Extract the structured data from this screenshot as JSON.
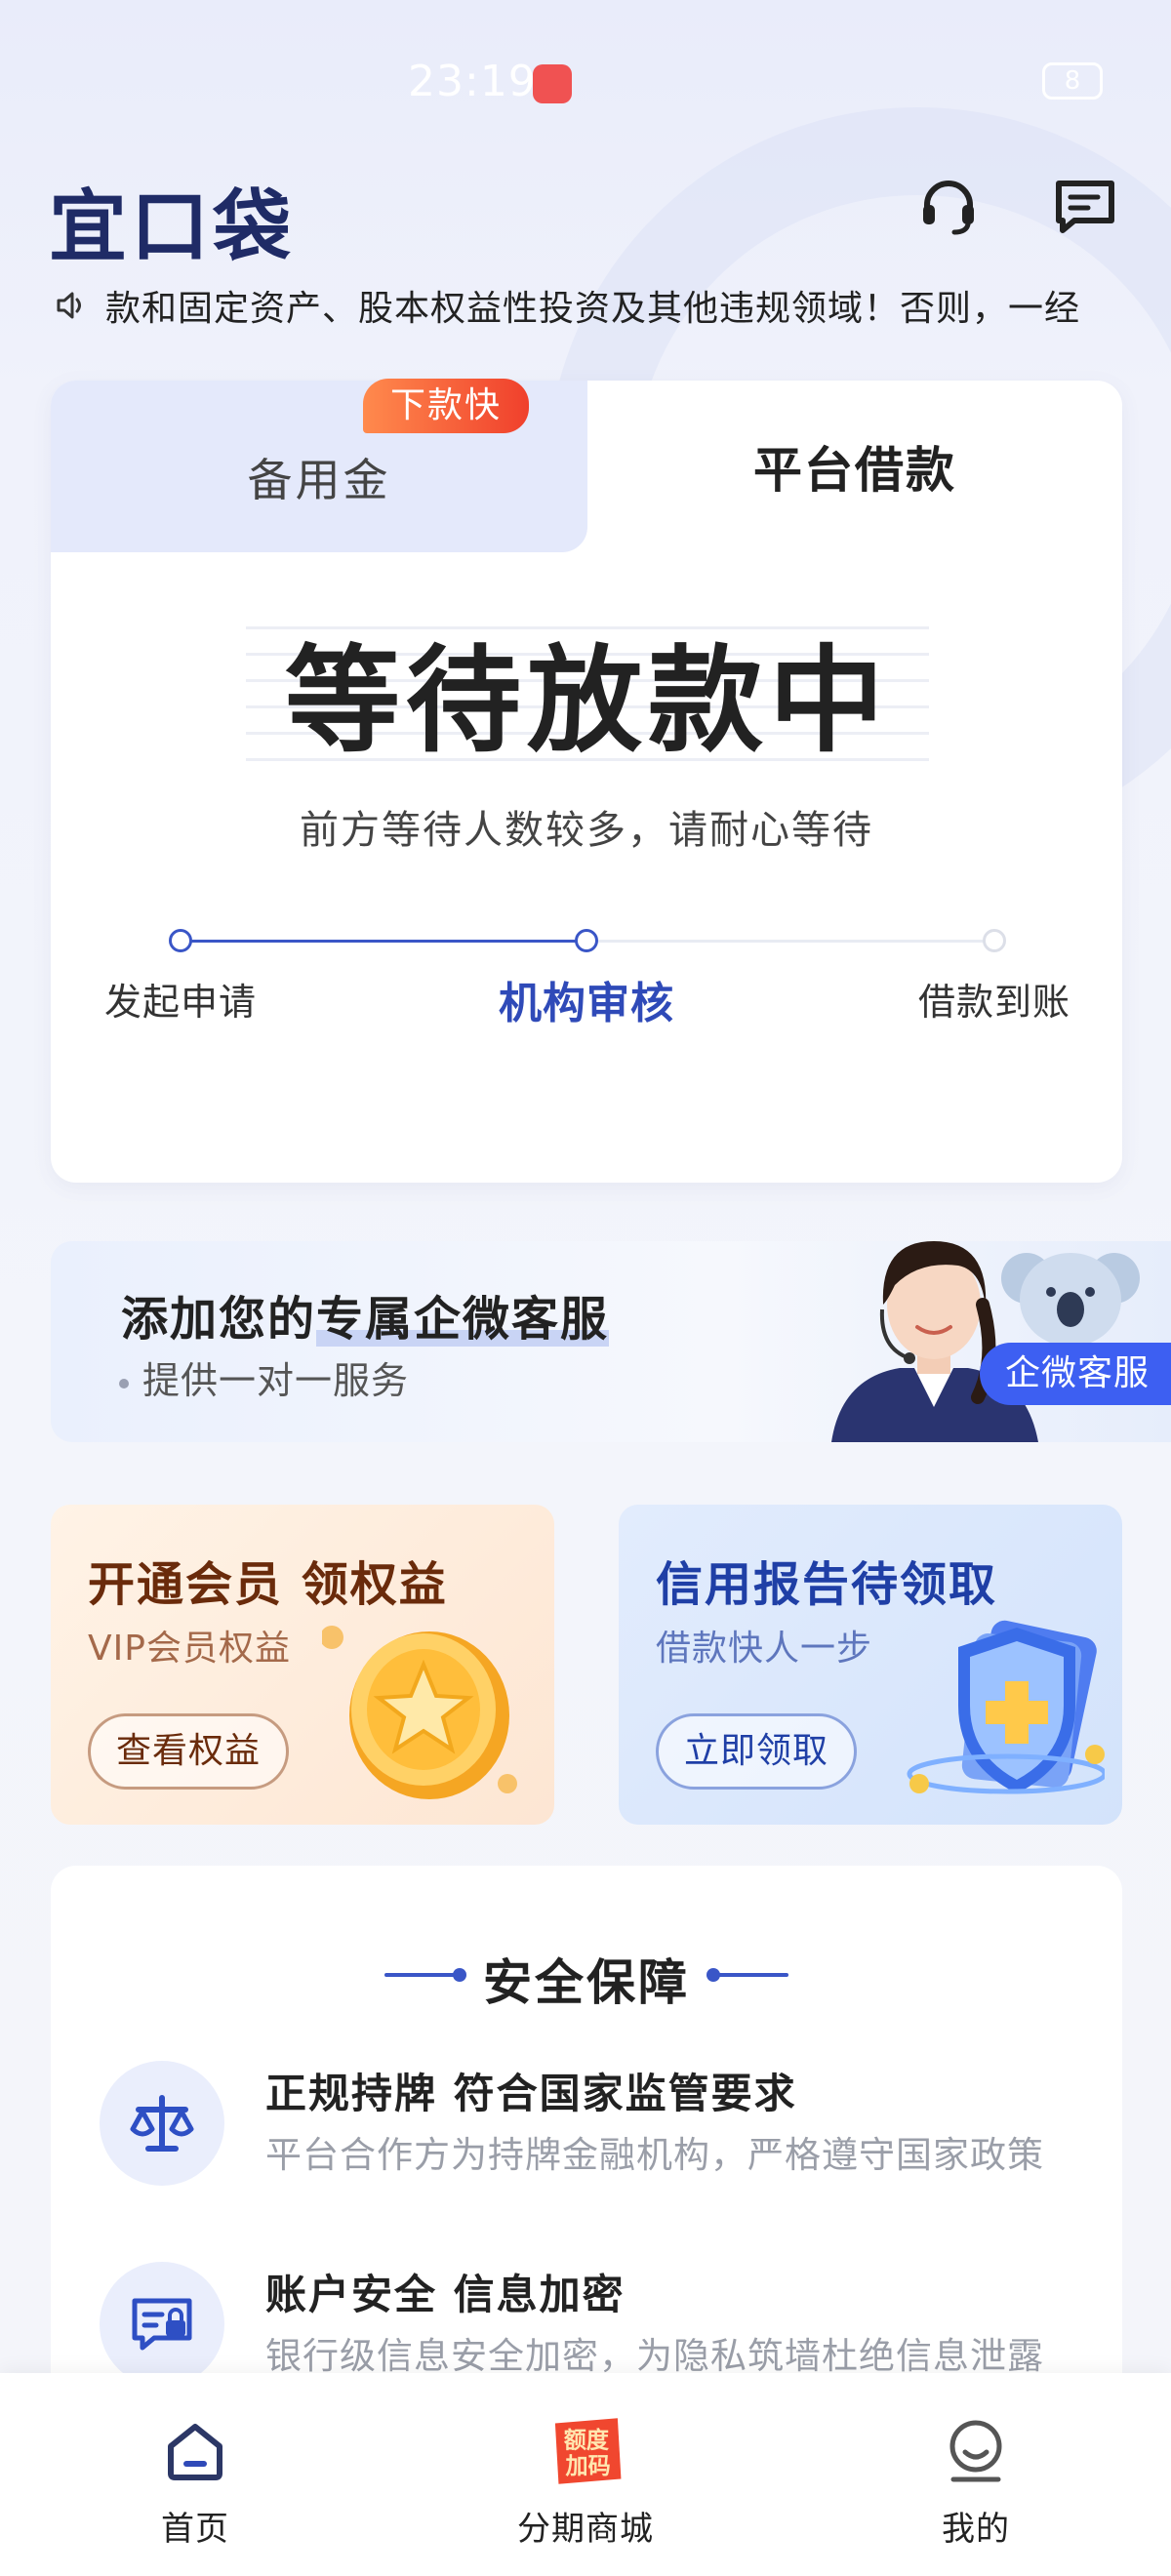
{
  "status_bar": {
    "time": "23:19",
    "battery": "8"
  },
  "header": {
    "logo": "宜口袋"
  },
  "notice": {
    "text": "款和固定资产、股本权益性投资及其他违规领域！否则，一经"
  },
  "loan_card": {
    "tabs": [
      {
        "label": "备用金",
        "badge": "下款快"
      },
      {
        "label": "平台借款"
      }
    ],
    "status_title": "等待放款中",
    "status_subtitle": "前方等待人数较多，请耐心等待",
    "steps": [
      {
        "label": "发起申请"
      },
      {
        "label": "机构审核"
      },
      {
        "label": "借款到账"
      }
    ]
  },
  "service_banner": {
    "title_prefix": "添加您的",
    "title_highlight": "专属企微客服",
    "subtitle": "提供一对一服务",
    "button": "企微客服"
  },
  "promos": [
    {
      "title": "开通会员 领权益",
      "subtitle": "VIP会员权益",
      "button": "查看权益"
    },
    {
      "title": "信用报告待领取",
      "subtitle": "借款快人一步",
      "button": "立即领取"
    }
  ],
  "security": {
    "title": "安全保障",
    "items": [
      {
        "title": "正规持牌 符合国家监管要求",
        "desc": "平台合作方为持牌金融机构，严格遵守国家政策"
      },
      {
        "title": "账户安全 信息加密",
        "desc": "银行级信息安全加密，为隐私筑墙杜绝信息泄露"
      }
    ]
  },
  "bottom_nav": {
    "items": [
      {
        "label": "首页"
      },
      {
        "label": "分期商城",
        "badge_line1": "额度",
        "badge_line2": "加码"
      },
      {
        "label": "我的"
      }
    ]
  }
}
